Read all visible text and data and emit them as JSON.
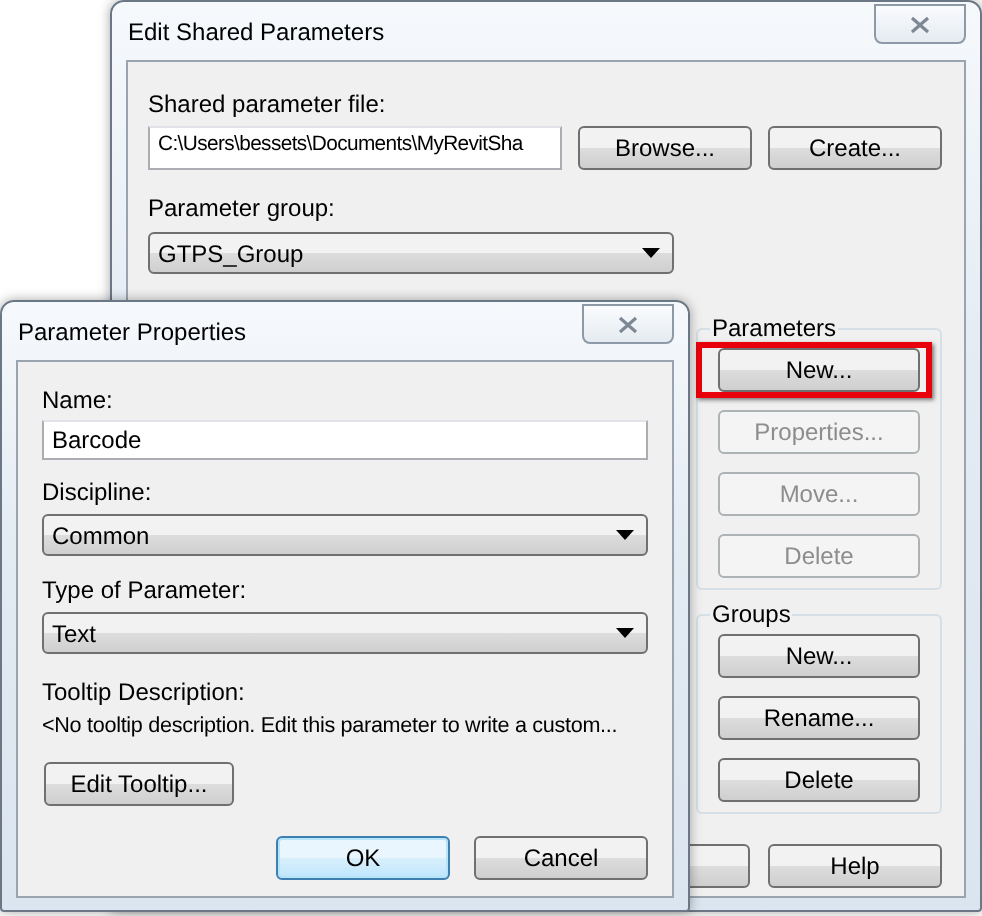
{
  "shared_parameters_dialog": {
    "title": "Edit Shared Parameters",
    "file_label": "Shared parameter file:",
    "file_path": "C:\\Users\\bessets\\Documents\\MyRevitSha",
    "file_buttons": [
      {
        "label": "Browse...",
        "disabled": false
      },
      {
        "label": "Create...",
        "disabled": false
      }
    ],
    "group_label": "Parameter group:",
    "group_value": "GTPS_Group",
    "parameters_box": {
      "title": "Parameters",
      "buttons": [
        {
          "label": "New...",
          "disabled": false,
          "highlighted": true
        },
        {
          "label": "Properties...",
          "disabled": true,
          "highlighted": false
        },
        {
          "label": "Move...",
          "disabled": true,
          "highlighted": false
        },
        {
          "label": "Delete",
          "disabled": true,
          "highlighted": false
        }
      ]
    },
    "groups_box": {
      "title": "Groups",
      "buttons": [
        {
          "label": "New...",
          "disabled": false,
          "highlighted": false
        },
        {
          "label": "Rename...",
          "disabled": false,
          "highlighted": false
        },
        {
          "label": "Delete",
          "disabled": false,
          "highlighted": false
        }
      ]
    },
    "footer_buttons": [
      {
        "label": "Help",
        "disabled": false
      }
    ]
  },
  "properties_dialog": {
    "title": "Parameter Properties",
    "name_label": "Name:",
    "name_value": "Barcode",
    "discipline_label": "Discipline:",
    "discipline_value": "Common",
    "type_label": "Type of Parameter:",
    "type_value": "Text",
    "tooltip_label": "Tooltip Description:",
    "tooltip_text": "<No tooltip description. Edit this parameter to write a custom...",
    "edit_tooltip_button": "Edit Tooltip...",
    "buttons": [
      {
        "label": "OK",
        "default": true
      },
      {
        "label": "Cancel",
        "default": false
      }
    ]
  }
}
